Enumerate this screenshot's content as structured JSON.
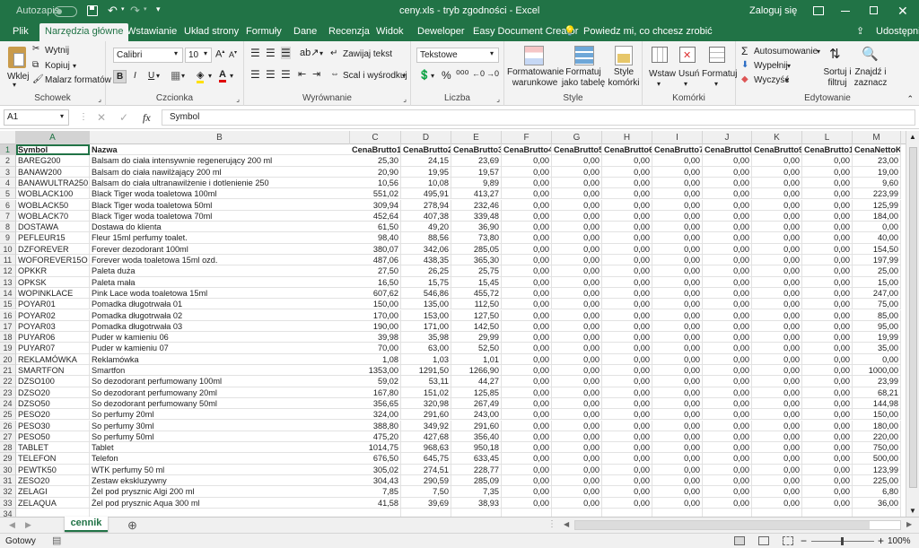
{
  "titlebar": {
    "autosave_label": "Autozapis",
    "autosave_state": "off",
    "title": "ceny.xls  -  tryb zgodności  -  Excel",
    "login": "Zaloguj się"
  },
  "tabs": [
    "Plik",
    "Narzędzia główne",
    "Wstawianie",
    "Układ strony",
    "Formuły",
    "Dane",
    "Recenzja",
    "Widok",
    "Deweloper",
    "Easy Document Creator"
  ],
  "tell_me": "Powiedz mi, co chcesz zrobić",
  "share": "Udostępnij",
  "ribbon": {
    "clipboard": {
      "paste": "Wklej",
      "cut": "Wytnij",
      "copy": "Kopiuj",
      "painter": "Malarz formatów",
      "label": "Schowek"
    },
    "font": {
      "name": "Calibri",
      "size": "10",
      "bold": "B",
      "italic": "I",
      "underline": "U",
      "label": "Czcionka"
    },
    "alignment": {
      "wrap": "Zawijaj tekst",
      "merge": "Scal i wyśrodkuj",
      "label": "Wyrównanie"
    },
    "number": {
      "format": "Tekstowe",
      "label": "Liczba"
    },
    "styles": {
      "cond": "Formatowanie warunkowe",
      "table": "Formatuj jako tabelę",
      "cell": "Style komórki",
      "label": "Style"
    },
    "cells": {
      "insert": "Wstaw",
      "delete": "Usuń",
      "format": "Formatuj",
      "label": "Komórki"
    },
    "editing": {
      "autosum": "Autosumowanie",
      "fill": "Wypełnij",
      "clear": "Wyczyść",
      "sort": "Sortuj i filtruj",
      "find": "Znajdź i zaznacz",
      "label": "Edytowanie"
    }
  },
  "formula": {
    "namebox": "A1",
    "fx": "fx",
    "value": "Symbol"
  },
  "columns": [
    "A",
    "B",
    "C",
    "D",
    "E",
    "F",
    "G",
    "H",
    "I",
    "J",
    "K",
    "L",
    "M"
  ],
  "headers": [
    "Symbol",
    "Nazwa",
    "CenaBrutto1",
    "CenaBrutto2",
    "CenaBrutto3",
    "CenaBrutto4",
    "CenaBrutto5",
    "CenaBrutto6",
    "CenaBrutto7",
    "CenaBrutto8",
    "CenaBrutto9",
    "CenaBrutto10",
    "CenaNettoK"
  ],
  "rows": [
    [
      "BAREG200",
      "Balsam do ciała intensywnie regenerujący 200 ml",
      "25,30",
      "24,15",
      "23,69",
      "0,00",
      "0,00",
      "0,00",
      "0,00",
      "0,00",
      "0,00",
      "0,00",
      "23,00"
    ],
    [
      "BANAW200",
      "Balsam do ciała nawilżający 200 ml",
      "20,90",
      "19,95",
      "19,57",
      "0,00",
      "0,00",
      "0,00",
      "0,00",
      "0,00",
      "0,00",
      "0,00",
      "19,00"
    ],
    [
      "BANAWULTRA250",
      "Balsam do ciała ultranawilżenie i dotlenienie 250",
      "10,56",
      "10,08",
      "9,89",
      "0,00",
      "0,00",
      "0,00",
      "0,00",
      "0,00",
      "0,00",
      "0,00",
      "9,60"
    ],
    [
      "WOBLACK100",
      "Black Tiger woda toaletowa 100ml",
      "551,02",
      "495,91",
      "413,27",
      "0,00",
      "0,00",
      "0,00",
      "0,00",
      "0,00",
      "0,00",
      "0,00",
      "223,99"
    ],
    [
      "WOBLACK50",
      "Black Tiger woda toaletowa 50ml",
      "309,94",
      "278,94",
      "232,46",
      "0,00",
      "0,00",
      "0,00",
      "0,00",
      "0,00",
      "0,00",
      "0,00",
      "125,99"
    ],
    [
      "WOBLACK70",
      "Black Tiger woda toaletowa 70ml",
      "452,64",
      "407,38",
      "339,48",
      "0,00",
      "0,00",
      "0,00",
      "0,00",
      "0,00",
      "0,00",
      "0,00",
      "184,00"
    ],
    [
      "DOSTAWA",
      "Dostawa do klienta",
      "61,50",
      "49,20",
      "36,90",
      "0,00",
      "0,00",
      "0,00",
      "0,00",
      "0,00",
      "0,00",
      "0,00",
      "0,00"
    ],
    [
      "PEFLEUR15",
      "Fleur 15ml perfumy toalet.",
      "98,40",
      "88,56",
      "73,80",
      "0,00",
      "0,00",
      "0,00",
      "0,00",
      "0,00",
      "0,00",
      "0,00",
      "40,00"
    ],
    [
      "DZFOREVER",
      "Forever dezodorant 100ml",
      "380,07",
      "342,06",
      "285,05",
      "0,00",
      "0,00",
      "0,00",
      "0,00",
      "0,00",
      "0,00",
      "0,00",
      "154,50"
    ],
    [
      "WOFOREVER15O",
      "Forever woda toaletowa 15ml ozd.",
      "487,06",
      "438,35",
      "365,30",
      "0,00",
      "0,00",
      "0,00",
      "0,00",
      "0,00",
      "0,00",
      "0,00",
      "197,99"
    ],
    [
      "OPKKR",
      "Paleta duża",
      "27,50",
      "26,25",
      "25,75",
      "0,00",
      "0,00",
      "0,00",
      "0,00",
      "0,00",
      "0,00",
      "0,00",
      "25,00"
    ],
    [
      "OPKSK",
      "Paleta mała",
      "16,50",
      "15,75",
      "15,45",
      "0,00",
      "0,00",
      "0,00",
      "0,00",
      "0,00",
      "0,00",
      "0,00",
      "15,00"
    ],
    [
      "WOPINKLACE",
      "Pink Lace woda toaletowa 15ml",
      "607,62",
      "546,86",
      "455,72",
      "0,00",
      "0,00",
      "0,00",
      "0,00",
      "0,00",
      "0,00",
      "0,00",
      "247,00"
    ],
    [
      "POYAR01",
      "Pomadka długotrwała 01",
      "150,00",
      "135,00",
      "112,50",
      "0,00",
      "0,00",
      "0,00",
      "0,00",
      "0,00",
      "0,00",
      "0,00",
      "75,00"
    ],
    [
      "POYAR02",
      "Pomadka długotrwała 02",
      "170,00",
      "153,00",
      "127,50",
      "0,00",
      "0,00",
      "0,00",
      "0,00",
      "0,00",
      "0,00",
      "0,00",
      "85,00"
    ],
    [
      "POYAR03",
      "Pomadka długotrwała 03",
      "190,00",
      "171,00",
      "142,50",
      "0,00",
      "0,00",
      "0,00",
      "0,00",
      "0,00",
      "0,00",
      "0,00",
      "95,00"
    ],
    [
      "PUYAR06",
      "Puder w kamieniu 06",
      "39,98",
      "35,98",
      "29,99",
      "0,00",
      "0,00",
      "0,00",
      "0,00",
      "0,00",
      "0,00",
      "0,00",
      "19,99"
    ],
    [
      "PUYAR07",
      "Puder w kamieniu 07",
      "70,00",
      "63,00",
      "52,50",
      "0,00",
      "0,00",
      "0,00",
      "0,00",
      "0,00",
      "0,00",
      "0,00",
      "35,00"
    ],
    [
      "REKLAMÓWKA",
      "Reklamówka",
      "1,08",
      "1,03",
      "1,01",
      "0,00",
      "0,00",
      "0,00",
      "0,00",
      "0,00",
      "0,00",
      "0,00",
      "0,00"
    ],
    [
      "SMARTFON",
      "Smartfon",
      "1353,00",
      "1291,50",
      "1266,90",
      "0,00",
      "0,00",
      "0,00",
      "0,00",
      "0,00",
      "0,00",
      "0,00",
      "1000,00"
    ],
    [
      "DZSO100",
      "So dezodorant perfumowany 100ml",
      "59,02",
      "53,11",
      "44,27",
      "0,00",
      "0,00",
      "0,00",
      "0,00",
      "0,00",
      "0,00",
      "0,00",
      "23,99"
    ],
    [
      "DZSO20",
      "So dezodorant perfumowany 20ml",
      "167,80",
      "151,02",
      "125,85",
      "0,00",
      "0,00",
      "0,00",
      "0,00",
      "0,00",
      "0,00",
      "0,00",
      "68,21"
    ],
    [
      "DZSO50",
      "So dezodorant perfumowany 50ml",
      "356,65",
      "320,98",
      "267,49",
      "0,00",
      "0,00",
      "0,00",
      "0,00",
      "0,00",
      "0,00",
      "0,00",
      "144,98"
    ],
    [
      "PESO20",
      "So perfumy 20ml",
      "324,00",
      "291,60",
      "243,00",
      "0,00",
      "0,00",
      "0,00",
      "0,00",
      "0,00",
      "0,00",
      "0,00",
      "150,00"
    ],
    [
      "PESO30",
      "So perfumy 30ml",
      "388,80",
      "349,92",
      "291,60",
      "0,00",
      "0,00",
      "0,00",
      "0,00",
      "0,00",
      "0,00",
      "0,00",
      "180,00"
    ],
    [
      "PESO50",
      "So perfumy 50ml",
      "475,20",
      "427,68",
      "356,40",
      "0,00",
      "0,00",
      "0,00",
      "0,00",
      "0,00",
      "0,00",
      "0,00",
      "220,00"
    ],
    [
      "TABLET",
      "Tablet",
      "1014,75",
      "968,63",
      "950,18",
      "0,00",
      "0,00",
      "0,00",
      "0,00",
      "0,00",
      "0,00",
      "0,00",
      "750,00"
    ],
    [
      "TELEFON",
      "Telefon",
      "676,50",
      "645,75",
      "633,45",
      "0,00",
      "0,00",
      "0,00",
      "0,00",
      "0,00",
      "0,00",
      "0,00",
      "500,00"
    ],
    [
      "PEWTK50",
      "WTK perfumy 50 ml",
      "305,02",
      "274,51",
      "228,77",
      "0,00",
      "0,00",
      "0,00",
      "0,00",
      "0,00",
      "0,00",
      "0,00",
      "123,99"
    ],
    [
      "ZESO20",
      "Zestaw ekskluzywny",
      "304,43",
      "290,59",
      "285,09",
      "0,00",
      "0,00",
      "0,00",
      "0,00",
      "0,00",
      "0,00",
      "0,00",
      "225,00"
    ],
    [
      "ZELAGI",
      "Żel pod prysznic Algi 200 ml",
      "7,85",
      "7,50",
      "7,35",
      "0,00",
      "0,00",
      "0,00",
      "0,00",
      "0,00",
      "0,00",
      "0,00",
      "6,80"
    ],
    [
      "ZELAQUA",
      "Żel pod prysznic Aqua 300 ml",
      "41,58",
      "39,69",
      "38,93",
      "0,00",
      "0,00",
      "0,00",
      "0,00",
      "0,00",
      "0,00",
      "0,00",
      "36,00"
    ],
    [
      "",
      "",
      "",
      "",
      "",
      "",
      "",
      "",
      "",
      "",
      "",
      "",
      ""
    ]
  ],
  "sheet_tab": "cennik",
  "status": {
    "ready": "Gotowy",
    "zoom": "100%"
  },
  "colors": {
    "excel_green": "#217346"
  }
}
